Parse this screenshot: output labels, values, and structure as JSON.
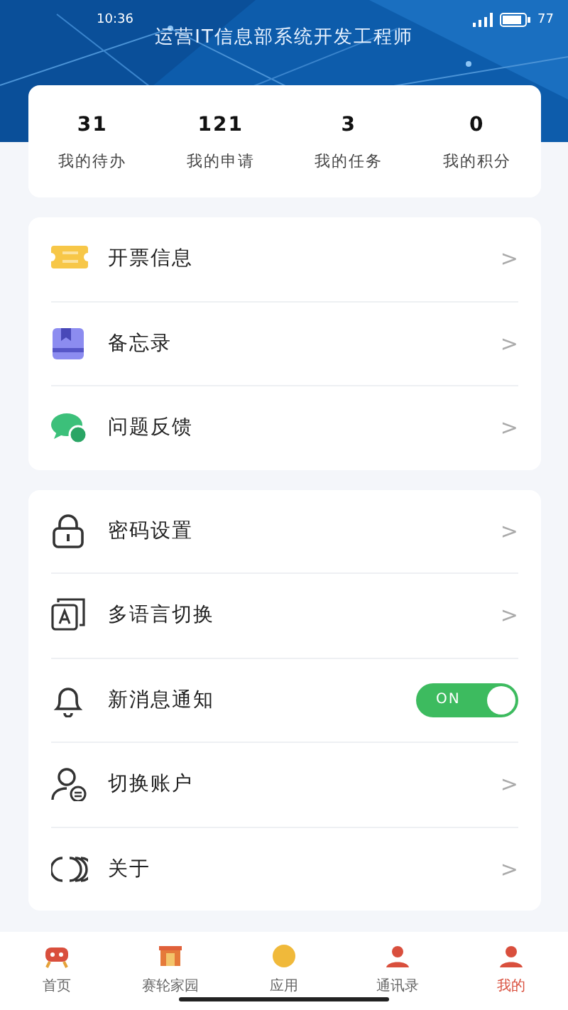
{
  "status_bar": {
    "time": "10:36",
    "battery": "77"
  },
  "profile": {
    "subtitle": "运营IT信息部系统开发工程师"
  },
  "stats": [
    {
      "value": "31",
      "label": "我的待办"
    },
    {
      "value": "121",
      "label": "我的申请"
    },
    {
      "value": "3",
      "label": "我的任务"
    },
    {
      "value": "0",
      "label": "我的积分"
    }
  ],
  "menu_groups": [
    [
      {
        "kind": "link",
        "label": "开票信息",
        "arrow": ">"
      },
      {
        "kind": "link",
        "label": "备忘录",
        "arrow": ">"
      },
      {
        "kind": "link",
        "label": "问题反馈",
        "arrow": ">"
      }
    ],
    [
      {
        "kind": "link",
        "label": "密码设置",
        "arrow": ">"
      },
      {
        "kind": "link",
        "label": "多语言切换",
        "arrow": ">"
      },
      {
        "kind": "toggle",
        "label": "新消息通知",
        "on": true,
        "toggle_text": "ON"
      },
      {
        "kind": "link",
        "label": "切换账户",
        "arrow": ">"
      },
      {
        "kind": "link",
        "label": "关于",
        "arrow": ">"
      }
    ]
  ],
  "tabs": [
    {
      "label": "首页",
      "selected": false
    },
    {
      "label": "赛轮家园",
      "selected": false
    },
    {
      "label": "应用",
      "selected": false
    },
    {
      "label": "通讯录",
      "selected": false
    },
    {
      "label": "我的",
      "selected": true
    }
  ]
}
